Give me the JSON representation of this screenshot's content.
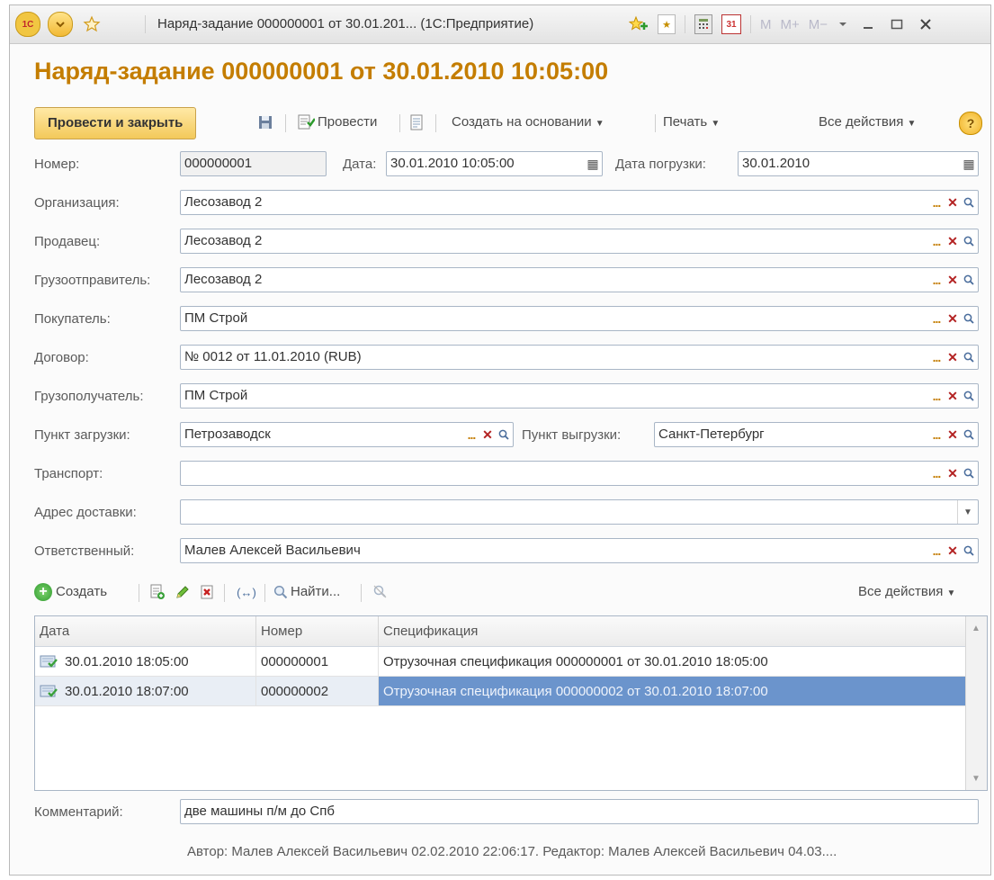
{
  "window": {
    "title": "Наряд-задание 000000001 от 30.01.201... (1С:Предприятие)",
    "logo": "1С",
    "calc_buttons": [
      "M",
      "M+",
      "M−"
    ]
  },
  "form": {
    "title": "Наряд-задание 000000001 от 30.01.2010 10:05:00"
  },
  "toolbar": {
    "post_close": "Провести и закрыть",
    "post": "Провести",
    "create_based": "Создать на основании",
    "print": "Печать",
    "all_actions": "Все действия",
    "help": "?"
  },
  "fields": {
    "number": {
      "label": "Номер:",
      "value": "000000001"
    },
    "date": {
      "label": "Дата:",
      "value": "30.01.2010 10:05:00"
    },
    "load_date": {
      "label": "Дата погрузки:",
      "value": "30.01.2010"
    },
    "organization": {
      "label": "Организация:",
      "value": "Лесозавод 2"
    },
    "seller": {
      "label": "Продавец:",
      "value": "Лесозавод 2"
    },
    "shipper": {
      "label": "Грузоотправитель:",
      "value": "Лесозавод 2"
    },
    "buyer": {
      "label": "Покупатель:",
      "value": "ПМ Строй"
    },
    "contract": {
      "label": "Договор:",
      "value": "№ 0012 от 11.01.2010 (RUB)"
    },
    "consignee": {
      "label": "Грузополучатель:",
      "value": "ПМ Строй"
    },
    "load_point": {
      "label": "Пункт загрузки:",
      "value": "Петрозаводск"
    },
    "unload_point": {
      "label": "Пункт выгрузки:",
      "value": "Санкт-Петербург"
    },
    "transport": {
      "label": "Транспорт:",
      "value": ""
    },
    "delivery_address": {
      "label": "Адрес доставки:",
      "value": ""
    },
    "responsible": {
      "label": "Ответственный:",
      "value": "Малев Алексей Васильевич"
    },
    "comment": {
      "label": "Комментарий:",
      "value": "две машины п/м до Спб"
    }
  },
  "table_toolbar": {
    "create": "Создать",
    "find": "Найти...",
    "all_actions": "Все действия"
  },
  "table": {
    "columns": [
      "Дата",
      "Номер",
      "Спецификация"
    ],
    "rows": [
      {
        "date": "30.01.2010 18:05:00",
        "number": "000000001",
        "spec": "Отрузочная спецификация 000000001 от 30.01.2010 18:05:00"
      },
      {
        "date": "30.01.2010 18:07:00",
        "number": "000000002",
        "spec": "Отрузочная спецификация 000000002 от 30.01.2010 18:07:00"
      }
    ]
  },
  "footer": {
    "text": "Автор: Малев Алексей Васильевич 02.02.2010 22:06:17. Редактор: Малев Алексей Васильевич 04.03...."
  },
  "colors": {
    "title_accent": "#c47d00",
    "selection": "#6b94cc"
  }
}
